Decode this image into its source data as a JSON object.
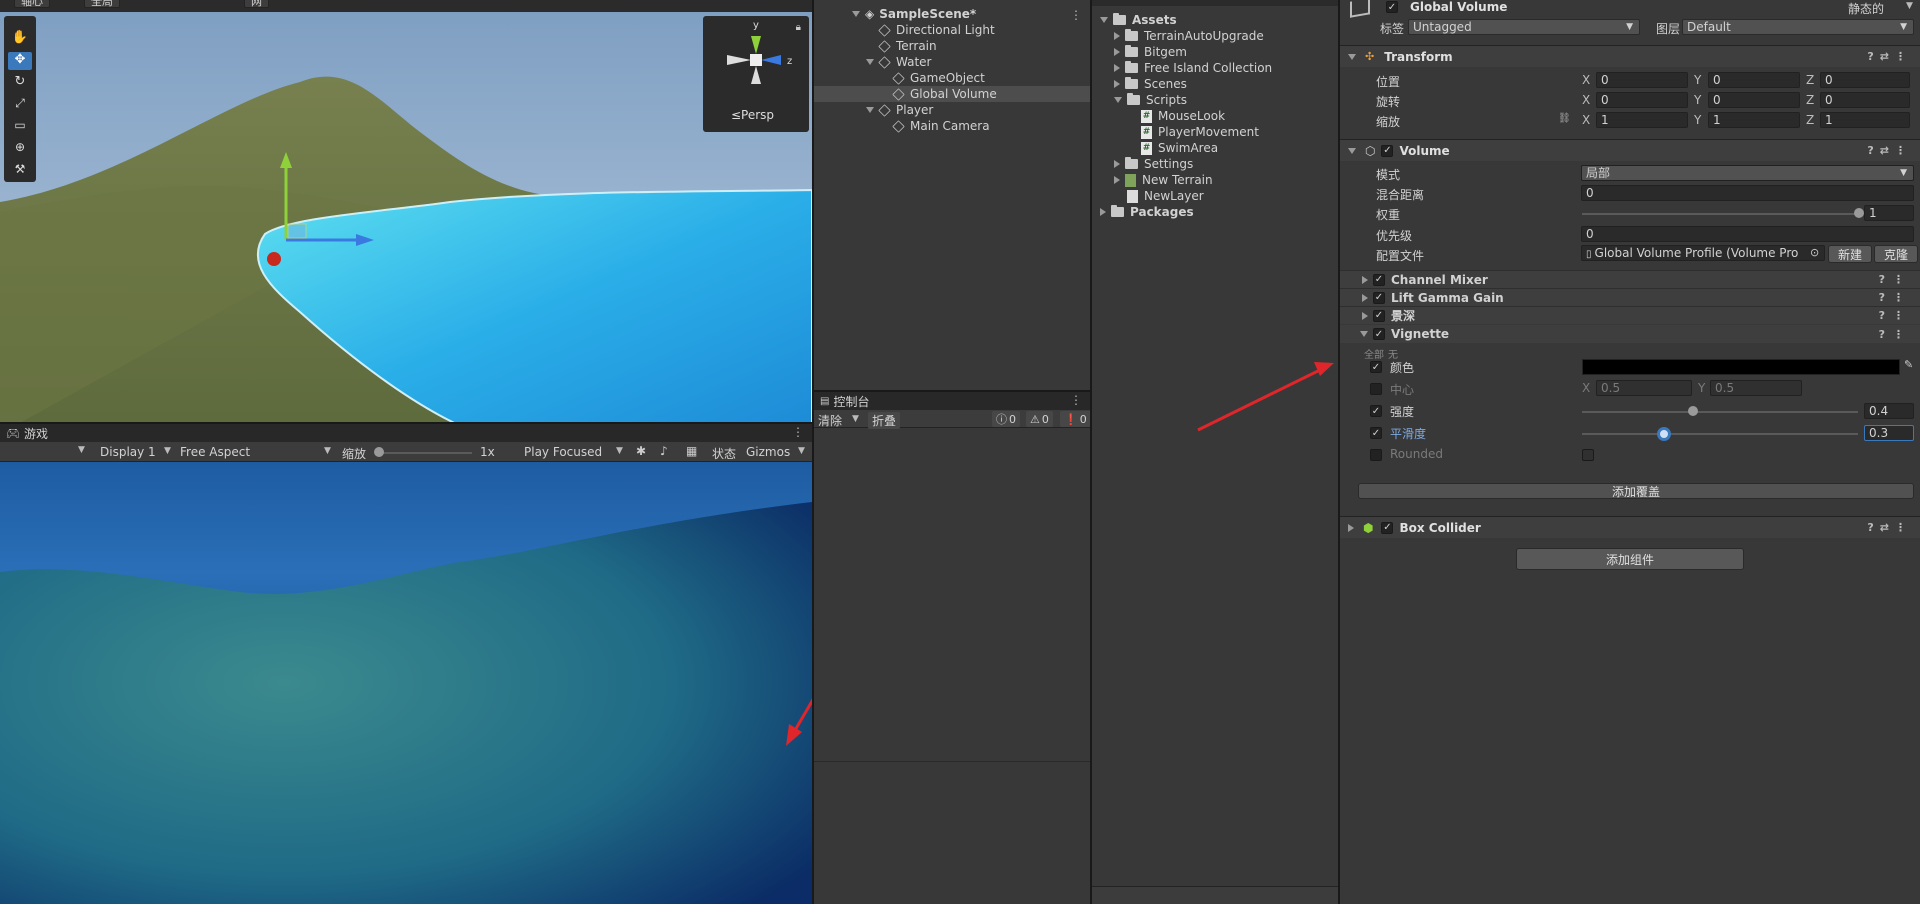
{
  "scene_toolbar": {
    "labels": [
      "轴心",
      "全局",
      "网"
    ]
  },
  "scene_view": {
    "persp_label": "≤Persp",
    "gizmo_axes": {
      "y": "y",
      "z": "z"
    }
  },
  "game_view": {
    "tab": "游戏",
    "display": "Display 1",
    "aspect": "Free Aspect",
    "scale_label": "缩放",
    "scale_value": "1x",
    "play_mode": "Play Focused",
    "stats": "状态",
    "gizmos": "Gizmos"
  },
  "hierarchy": {
    "items": [
      {
        "label": "SampleScene*",
        "depth": 0,
        "type": "scene"
      },
      {
        "label": "Directional Light",
        "depth": 1,
        "type": "object"
      },
      {
        "label": "Terrain",
        "depth": 1,
        "type": "object"
      },
      {
        "label": "Water",
        "depth": 1,
        "type": "object"
      },
      {
        "label": "GameObject",
        "depth": 2,
        "type": "object"
      },
      {
        "label": "Global Volume",
        "depth": 2,
        "type": "object",
        "selected": true
      },
      {
        "label": "Player",
        "depth": 1,
        "type": "object"
      },
      {
        "label": "Main Camera",
        "depth": 2,
        "type": "object"
      }
    ]
  },
  "console": {
    "tab": "控制台",
    "clear": "清除",
    "collapse": "折叠",
    "counts": {
      "info": "0",
      "warn": "0",
      "error": "0"
    }
  },
  "project": {
    "items": [
      {
        "label": "Assets",
        "depth": 0,
        "type": "folder"
      },
      {
        "label": "TerrainAutoUpgrade",
        "depth": 1,
        "type": "folder"
      },
      {
        "label": "Bitgem",
        "depth": 1,
        "type": "folder"
      },
      {
        "label": "Free Island Collection",
        "depth": 1,
        "type": "folder"
      },
      {
        "label": "Scenes",
        "depth": 1,
        "type": "folder"
      },
      {
        "label": "Scripts",
        "depth": 1,
        "type": "folder"
      },
      {
        "label": "MouseLook",
        "depth": 2,
        "type": "script"
      },
      {
        "label": "PlayerMovement",
        "depth": 2,
        "type": "script"
      },
      {
        "label": "SwimArea",
        "depth": 2,
        "type": "script"
      },
      {
        "label": "Settings",
        "depth": 1,
        "type": "folder"
      },
      {
        "label": "New Terrain",
        "depth": 1,
        "type": "terrain"
      },
      {
        "label": "NewLayer",
        "depth": 1,
        "type": "file"
      },
      {
        "label": "Packages",
        "depth": 0,
        "type": "folder"
      }
    ]
  },
  "inspector": {
    "object_name": "Global Volume",
    "static_label": "静态的",
    "tag_label": "标签",
    "tag_value": "Untagged",
    "layer_label": "图层",
    "layer_value": "Default",
    "transform": {
      "title": "Transform",
      "position_label": "位置",
      "rotation_label": "旋转",
      "scale_label": "缩放",
      "position": [
        "0",
        "0",
        "0"
      ],
      "rotation": [
        "0",
        "0",
        "0"
      ],
      "scale": [
        "1",
        "1",
        "1"
      ]
    },
    "volume": {
      "title": "Volume",
      "mode_label": "模式",
      "mode_value": "局部",
      "blend_label": "混合距离",
      "blend_value": "0",
      "weight_label": "权重",
      "weight_value": "1",
      "priority_label": "优先级",
      "priority_value": "0",
      "profile_label": "配置文件",
      "profile_value": "Global Volume Profile (Volume Pro",
      "new_btn": "新建",
      "clone_btn": "克隆"
    },
    "overrides": [
      "Channel Mixer",
      "Lift Gamma Gain",
      "景深"
    ],
    "vignette": {
      "title": "Vignette",
      "all_label": "全部",
      "none_label": "无",
      "color_label": "颜色",
      "center_label": "中心",
      "center_x": "0.5",
      "center_y": "0.5",
      "intensity_label": "强度",
      "intensity_value": "0.4",
      "smoothness_label": "平滑度",
      "smoothness_value": "0.3",
      "rounded_label": "Rounded"
    },
    "add_override": "添加覆盖",
    "box_collider": "Box Collider",
    "add_component": "添加组件"
  },
  "colors": {
    "accent": "#3a79bb",
    "arrow": "#e0262a",
    "water": "#2aaee8",
    "game_bg": "#0c3f7a"
  }
}
